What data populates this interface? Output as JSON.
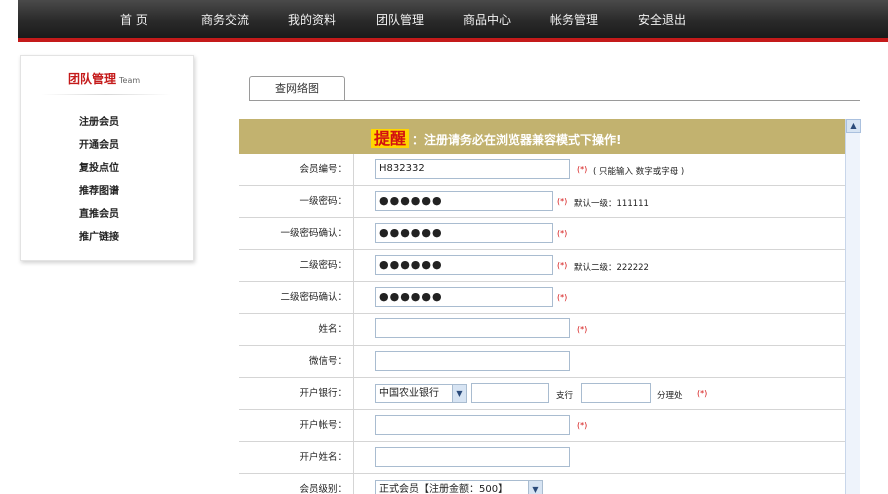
{
  "nav": {
    "items": [
      "首 页",
      "商务交流",
      "我的资料",
      "团队管理",
      "商品中心",
      "帐务管理",
      "安全退出"
    ]
  },
  "sidebar": {
    "title": "团队管理",
    "title_en": "Team",
    "items": [
      "注册会员",
      "开通会员",
      "复投点位",
      "推荐图谱",
      "直推会员",
      "推广链接"
    ]
  },
  "tab": {
    "label": "查网络图"
  },
  "banner": {
    "highlight": "提醒",
    "text": "：注册请务必在浏览器兼容模式下操作!"
  },
  "form": {
    "member_id": {
      "label": "会员编号：",
      "value": "H832332",
      "req": "(*)",
      "hint": "( 只能输入 数字或字母 )"
    },
    "pwd1": {
      "label": "一级密码：",
      "value": "●●●●●●",
      "req": "(*)",
      "hint": "默认一级：111111"
    },
    "pwd1_confirm": {
      "label": "一级密码确认：",
      "value": "●●●●●●",
      "req": "(*)"
    },
    "pwd2": {
      "label": "二级密码：",
      "value": "●●●●●●",
      "req": "(*)",
      "hint": "默认二级：222222"
    },
    "pwd2_confirm": {
      "label": "二级密码确认：",
      "value": "●●●●●●",
      "req": "(*)"
    },
    "name": {
      "label": "姓名：",
      "value": "",
      "req": "(*)"
    },
    "wechat": {
      "label": "微信号：",
      "value": ""
    },
    "bank": {
      "label": "开户银行：",
      "selected": "中国农业银行",
      "branch_label": "支行",
      "sub_label": "分理处",
      "req": "(*)"
    },
    "account_no": {
      "label": "开户帐号：",
      "value": "",
      "req": "(*)"
    },
    "account_name": {
      "label": "开户姓名：",
      "value": ""
    },
    "level": {
      "label": "会员级别：",
      "selected": "正式会员【注册金额：500】"
    }
  },
  "colors": {
    "nav_bg": "#2a2a2a",
    "accent_red": "#c41a1a",
    "banner_bg": "#c2b26f",
    "highlight_bg": "#ffd500"
  }
}
